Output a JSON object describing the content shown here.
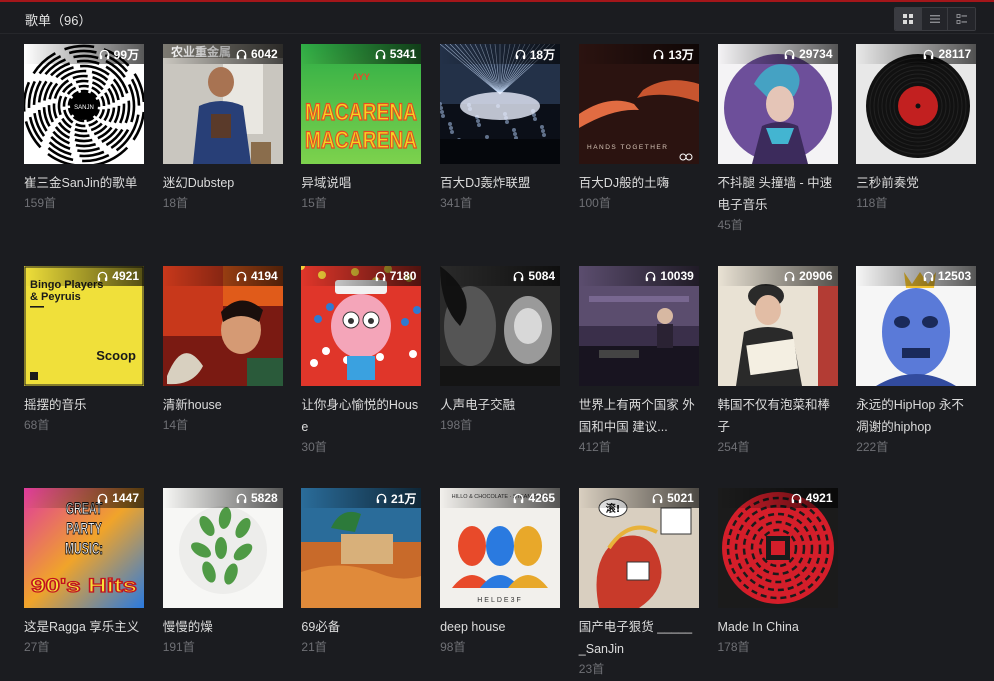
{
  "header": {
    "title": "歌单（96）"
  },
  "views": [
    "grid-view-icon",
    "list-view-icon",
    "detail-view-icon"
  ],
  "playlists": [
    {
      "name": "崔三金SanJin的歌单",
      "count": "159首",
      "plays": "99万",
      "cover": "spiral",
      "cover_text": "SANJN"
    },
    {
      "name": "迷幻Dubstep",
      "count": "18首",
      "plays": "6042",
      "cover": "photo-man",
      "cover_text": "农业重金属"
    },
    {
      "name": "异域说唱",
      "count": "15首",
      "plays": "5341",
      "cover": "macarena",
      "cover_text": "MACARENA",
      "cover_sub": "AYY"
    },
    {
      "name": "百大DJ轰炸联盟",
      "count": "341首",
      "plays": "18万",
      "cover": "concert"
    },
    {
      "name": "百大DJ般的土嗨",
      "count": "100首",
      "plays": "13万",
      "cover": "hands",
      "cover_text": "HANDS TOGETHER"
    },
    {
      "name": "不抖腿 头撞墙 - 中速电子音乐",
      "count": "45首",
      "plays": "29734",
      "cover": "purple-portrait"
    },
    {
      "name": "三秒前奏党",
      "count": "118首",
      "plays": "28117",
      "cover": "vinyl"
    },
    {
      "name": "摇摆的音乐",
      "count": "68首",
      "plays": "4921",
      "cover": "bingo",
      "cover_text": "Bingo Players & Peyruis",
      "cover_sub": "Scoop"
    },
    {
      "name": "清新house",
      "count": "14首",
      "plays": "4194",
      "cover": "red-art"
    },
    {
      "name": "让你身心愉悦的House",
      "count": "30首",
      "plays": "7180",
      "cover": "cartoon"
    },
    {
      "name": "人声电子交融",
      "count": "198首",
      "plays": "5084",
      "cover": "bw-photo"
    },
    {
      "name": "世界上有两个国家 外国和中国 建议...",
      "count": "412首",
      "plays": "10039",
      "cover": "dj-room"
    },
    {
      "name": "韩国不仅有泡菜和棒子",
      "count": "254首",
      "plays": "20906",
      "cover": "reader"
    },
    {
      "name": "永远的HipHop 永不凋谢的hiphop",
      "count": "222首",
      "plays": "12503",
      "cover": "blue-face"
    },
    {
      "name": "这是Ragga 享乐主义",
      "count": "27首",
      "plays": "1447",
      "cover": "great-party",
      "cover_text": "GREAT PARTY MUSIC:",
      "cover_sub": "90's Hits"
    },
    {
      "name": "慢慢的燥",
      "count": "191首",
      "plays": "5828",
      "cover": "leaves"
    },
    {
      "name": "69必备",
      "count": "21首",
      "plays": "21万",
      "cover": "desert"
    },
    {
      "name": "deep house",
      "count": "98首",
      "plays": "4265",
      "cover": "silhouettes",
      "cover_text": "HELDE3F",
      "cover_sub": "HILLO & CHOCOLATE · STEAM TRUE"
    },
    {
      "name": "国产电子狠货 ______SanJin",
      "count": "23首",
      "plays": "5021",
      "cover": "dragon-comic",
      "cover_text": "滚!"
    },
    {
      "name": "Made In China",
      "count": "178首",
      "plays": "4921",
      "cover": "red-dragon"
    }
  ],
  "colors": {
    "accent": "#a4161a",
    "background": "#1b1c20",
    "muted": "#6f7075"
  }
}
